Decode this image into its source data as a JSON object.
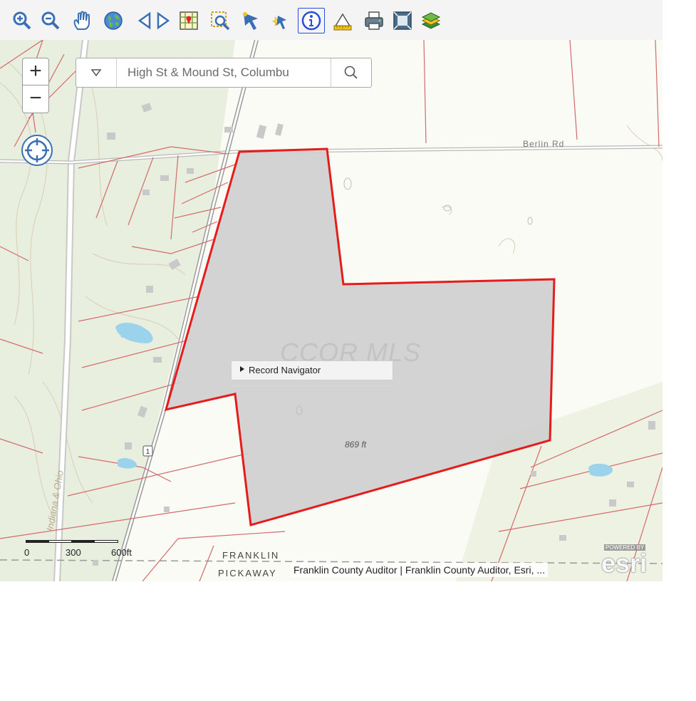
{
  "toolbar": {
    "tools": [
      {
        "name": "zoom-in-tool",
        "icon": "zoom-in-icon"
      },
      {
        "name": "zoom-out-tool",
        "icon": "zoom-out-icon"
      },
      {
        "name": "pan-tool",
        "icon": "hand-icon"
      },
      {
        "name": "full-extent-tool",
        "icon": "globe-icon"
      },
      {
        "name": "previous-extent-tool",
        "icon": "triangle-left-icon"
      },
      {
        "name": "next-extent-tool",
        "icon": "triangle-right-icon"
      },
      {
        "name": "map-tool",
        "icon": "map-icon"
      },
      {
        "name": "select-area-tool",
        "icon": "box-zoom-icon"
      },
      {
        "name": "select-tool",
        "icon": "arrow-pointer-icon"
      },
      {
        "name": "select-pointer-tool",
        "icon": "pointer-star-icon"
      },
      {
        "name": "identify-tool",
        "icon": "info-icon",
        "active": true
      },
      {
        "name": "measure-tool",
        "icon": "ruler-icon"
      },
      {
        "name": "print-tool",
        "icon": "printer-icon"
      },
      {
        "name": "full-screen-tool",
        "icon": "screen-icon"
      },
      {
        "name": "layers-tool",
        "icon": "layers-icon"
      }
    ]
  },
  "map": {
    "zoom_in_label": "+",
    "zoom_out_label": "−",
    "search": {
      "value": "High St & Mound St, Columbu"
    },
    "watermark": "CCOR MLS",
    "elevation_label": "869 ft",
    "record_navigator_label": "Record Navigator",
    "road_label": "Berlin Rd",
    "rail_label": "Indiana & Ohio",
    "route_shield": "1",
    "county_north": "FRANKLIN",
    "county_south": "PICKAWAY",
    "scale": {
      "ticks": [
        "0",
        "300",
        "600ft"
      ]
    },
    "attribution": "Franklin County Auditor | Franklin County Auditor, Esri, ...",
    "esri_powered": "POWERED BY",
    "esri_name": "esri",
    "colors": {
      "parcel_outline": "#e61b1b",
      "parcel_fill": "#cfcfcf",
      "parcel_lines": "#d46a6a",
      "water": "#9bd3ec"
    }
  }
}
